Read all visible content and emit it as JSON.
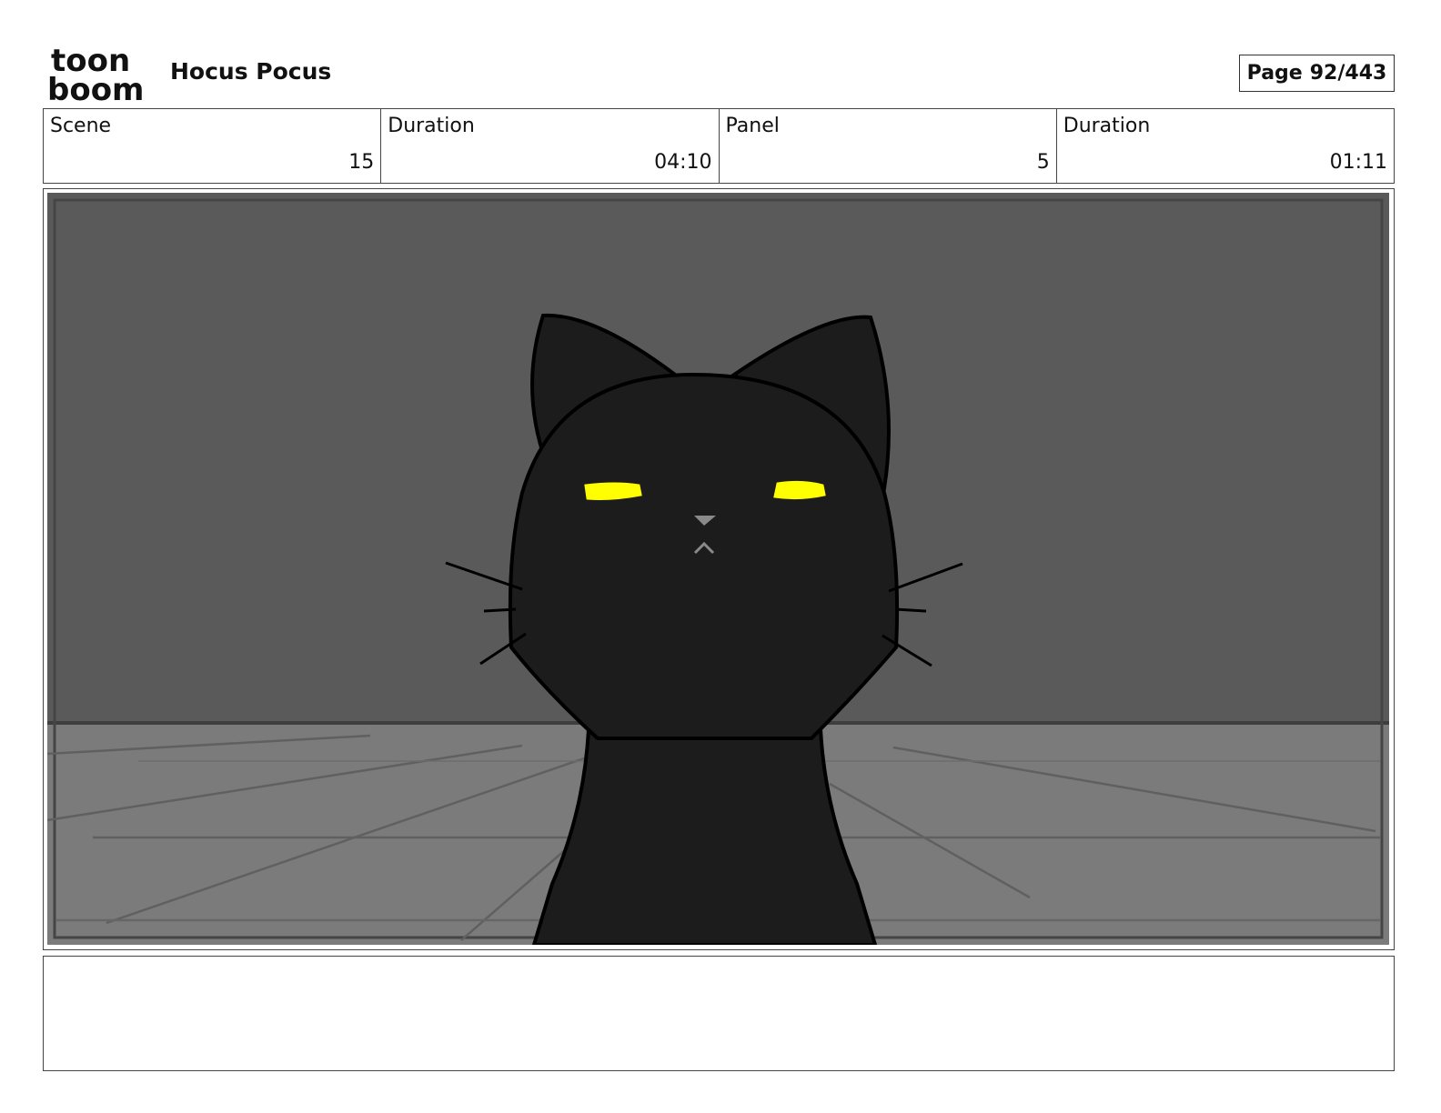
{
  "header": {
    "logo_line1": "toon",
    "logo_line2": "boom",
    "title": "Hocus Pocus",
    "page_label": "Page",
    "page_value": "92/443"
  },
  "info": {
    "scene_label": "Scene",
    "scene_value": "15",
    "scene_duration_label": "Duration",
    "scene_duration_value": "04:10",
    "panel_label": "Panel",
    "panel_value": "5",
    "panel_duration_label": "Duration",
    "panel_duration_value": "01:11"
  },
  "panel_image": {
    "subject": "black-cat",
    "colors": {
      "wall": "#5a5a5a",
      "floor": "#7b7b7b",
      "cat": "#1c1c1c",
      "eyes": "#ffff00",
      "nose": "#8a8a8a"
    }
  },
  "notes": {
    "text": ""
  }
}
